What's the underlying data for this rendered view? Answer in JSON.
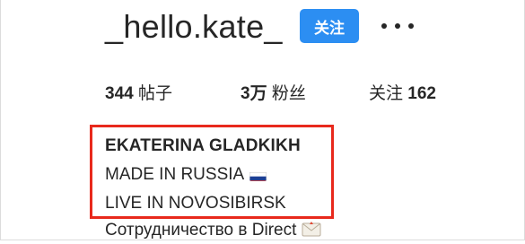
{
  "profile": {
    "username": "_hello.kate_",
    "follow_label": "关注",
    "more_icon": "more-horizontal-icon"
  },
  "stats": {
    "posts_value": "344",
    "posts_label": "帖子",
    "followers_value": "3万",
    "followers_label": "粉丝",
    "following_label": "关注",
    "following_value": "162"
  },
  "bio": {
    "name": "EKATERINA GLADKIKH",
    "line1": "MADE IN RUSSIA",
    "line1_icon": "russia-flag-icon",
    "line2": "LIVE IN NOVOSIBIRSK",
    "line3": "Сотрудничество в Direct",
    "line3_icon": "envelope-icon"
  },
  "colors": {
    "follow_button": "#2c8ef2",
    "highlight_box": "#e8291c",
    "text": "#262626"
  }
}
